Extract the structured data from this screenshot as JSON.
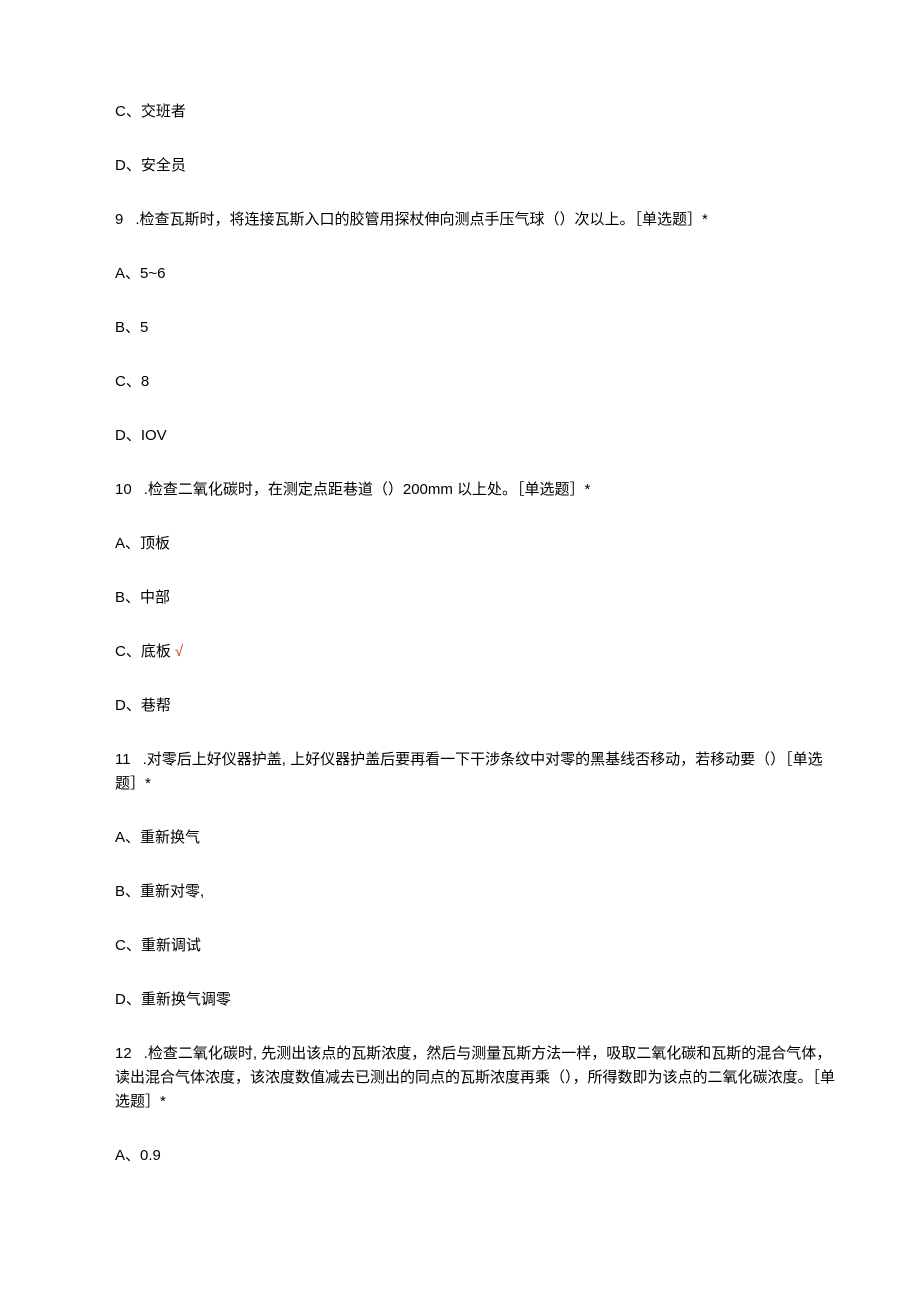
{
  "items": [
    {
      "type": "option",
      "text": "C、交班者"
    },
    {
      "type": "option",
      "text": "D、安全员"
    },
    {
      "type": "question",
      "num": "9",
      "text": ".检查瓦斯时，将连接瓦斯入口的胶管用探杖伸向测点手压气球（）次以上。［单选题］*"
    },
    {
      "type": "option",
      "text": "A、5~6"
    },
    {
      "type": "option",
      "text": "B、5"
    },
    {
      "type": "option",
      "text": "C、8"
    },
    {
      "type": "option",
      "text": "D、IOV"
    },
    {
      "type": "question",
      "num": "10",
      "text": ".检查二氧化碳时，在测定点距巷道（）200mm 以上处。［单选题］*"
    },
    {
      "type": "option",
      "text": "A、顶板"
    },
    {
      "type": "option",
      "text": "B、中部"
    },
    {
      "type": "option",
      "text": "C、底板",
      "correct": true
    },
    {
      "type": "option",
      "text": "D、巷帮"
    },
    {
      "type": "question",
      "num": "11",
      "text": ".对零后上好仪器护盖, 上好仪器护盖后要再看一下干涉条纹中对零的黑基线否移动，若移动要（）［单选题］*"
    },
    {
      "type": "option",
      "text": "A、重新换气"
    },
    {
      "type": "option",
      "text": "B、重新对零,"
    },
    {
      "type": "option",
      "text": "C、重新调试"
    },
    {
      "type": "option",
      "text": "D、重新换气调零"
    },
    {
      "type": "question",
      "num": "12",
      "text": ".检查二氧化碳时, 先测出该点的瓦斯浓度，然后与测量瓦斯方法一样，吸取二氧化碳和瓦斯的混合气体，读出混合气体浓度，该浓度数值减去已测出的同点的瓦斯浓度再乘（），所得数即为该点的二氧化碳浓度。［单选题］*"
    },
    {
      "type": "option",
      "text": "A、0.9"
    }
  ],
  "correct_mark": "√"
}
